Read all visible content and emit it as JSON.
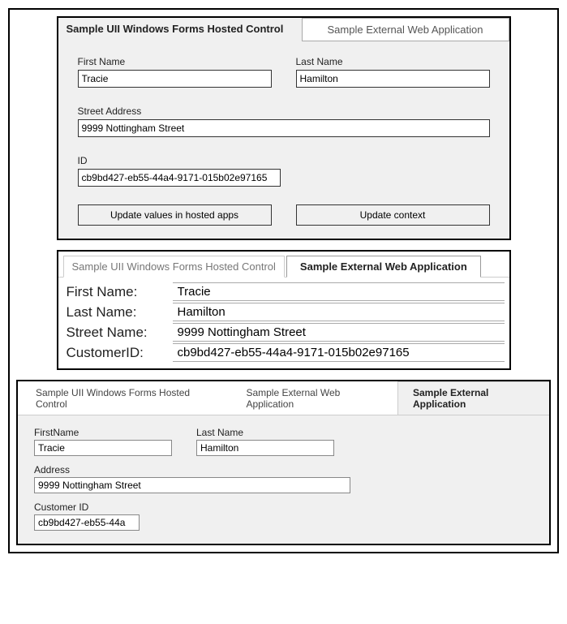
{
  "panel1": {
    "tab_active": "Sample UII Windows Forms Hosted Control",
    "tab_inactive": "Sample External Web Application",
    "first_name_label": "First Name",
    "first_name_value": "Tracie",
    "last_name_label": "Last Name",
    "last_name_value": "Hamilton",
    "street_label": "Street Address",
    "street_value": "9999 Nottingham Street",
    "id_label": "ID",
    "id_value": "cb9bd427-eb55-44a4-9171-015b02e97165",
    "btn_update_hosted": "Update values in hosted apps",
    "btn_update_context": "Update context"
  },
  "panel2": {
    "tab_inactive": "Sample UII Windows Forms Hosted Control",
    "tab_active": "Sample External Web Application",
    "first_name_label": "First Name:",
    "first_name_value": "Tracie",
    "last_name_label": "Last Name:",
    "last_name_value": "Hamilton",
    "street_label": "Street Name:",
    "street_value": "9999 Nottingham Street",
    "cust_label": "CustomerID:",
    "cust_value": "cb9bd427-eb55-44a4-9171-015b02e97165"
  },
  "panel3": {
    "tab1": "Sample UII Windows Forms Hosted Control",
    "tab2": "Sample External Web Application",
    "tab3": "Sample External Application",
    "first_name_label": "FirstName",
    "first_name_value": "Tracie",
    "last_name_label": "Last Name",
    "last_name_value": "Hamilton",
    "address_label": "Address",
    "address_value": "9999 Nottingham Street",
    "cust_label": "Customer ID",
    "cust_value": "cb9bd427-eb55-44a"
  }
}
